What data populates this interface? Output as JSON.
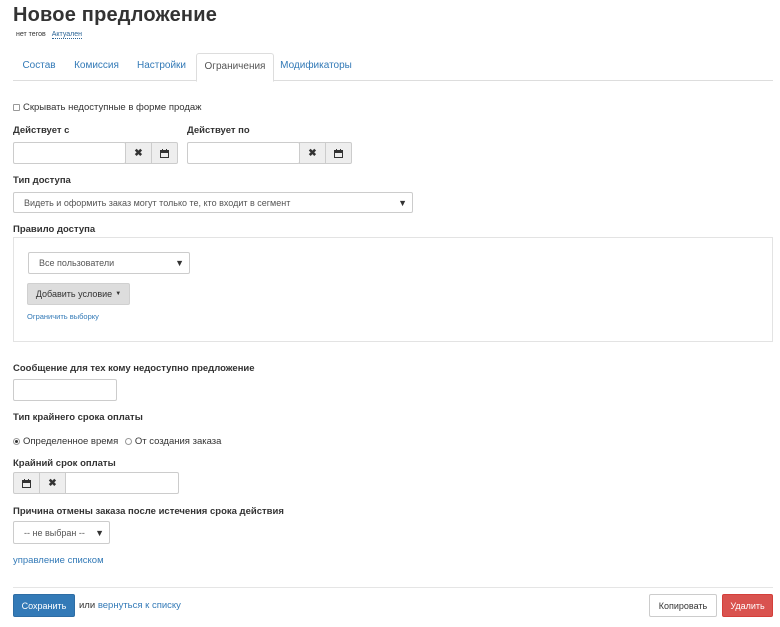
{
  "page": {
    "title": "Новое предложение",
    "status_prefix": "нет тегов",
    "status_link": "Актуален"
  },
  "tabs": [
    {
      "label": "Состав"
    },
    {
      "label": "Комиссия"
    },
    {
      "label": "Настройки"
    },
    {
      "label": "Ограничения"
    },
    {
      "label": "Модификаторы"
    }
  ],
  "form": {
    "hide_unavailable_label": "Скрывать недоступные в форме продаж",
    "valid_from_label": "Действует с",
    "valid_to_label": "Действует по",
    "valid_from_value": "",
    "valid_to_value": "",
    "access_type_label": "Тип доступа",
    "access_type_value": "Видеть и оформить заказ могут только те, кто входит в сегмент",
    "access_rule_label": "Правило доступа",
    "users_select_value": "Все пользователи",
    "add_condition_label": "Добавить условие",
    "limit_selection_link": "Ограничить выборку",
    "unavailable_message_label": "Сообщение для тех кому недоступно предложение",
    "unavailable_message_value": "",
    "deadline_type_label": "Тип крайнего срока оплаты",
    "deadline_option_fixed": "Определенное время",
    "deadline_option_from_order": "От создания заказа",
    "deadline_label": "Крайний срок оплаты",
    "deadline_value": "",
    "cancel_reason_label": "Причина отмены заказа после истечения срока действия",
    "cancel_reason_value": "-- не выбран --",
    "manage_list_link": "управление списком"
  },
  "footer": {
    "save_label": "Сохранить",
    "or_text": "или",
    "back_link": "вернуться к списку",
    "copy_label": "Копировать",
    "delete_label": "Удалить"
  },
  "colors": {
    "primary": "#337ab7",
    "danger": "#d9534f",
    "link": "#337ab7"
  }
}
